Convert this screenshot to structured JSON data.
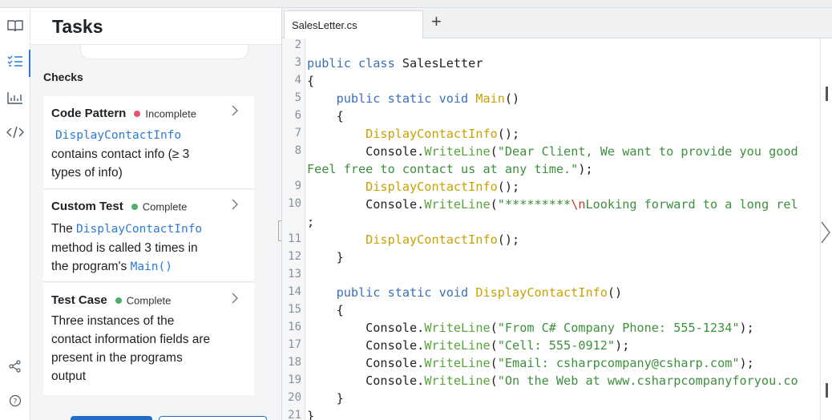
{
  "rail": {
    "icons": [
      "book-icon",
      "checklist-icon",
      "chart-icon",
      "code-icon",
      "share-icon",
      "help-icon"
    ]
  },
  "tasks": {
    "title": "Tasks",
    "checks_label": "Checks",
    "cards": [
      {
        "title": "Code Pattern",
        "status": "Incomplete",
        "status_color": "#e5566b",
        "code": "DisplayContactInfo",
        "desc_line1": "contains contact info (≥ 3",
        "desc_line2": "types of info)"
      },
      {
        "title": "Custom Test",
        "status": "Complete",
        "status_color": "#4caf6a",
        "pre": "The",
        "code": "DisplayContactInfo",
        "line2": "method is called 3 times in",
        "line3_pre": "the program's",
        "line3_code": "Main()"
      },
      {
        "title": "Test Case",
        "status": "Complete",
        "status_color": "#4caf6a",
        "lines": [
          "Three instances of the",
          "contact information fields are",
          "present in the programs",
          "output"
        ]
      }
    ]
  },
  "editor": {
    "tab_label": "SalesLetter.cs",
    "new_tab_symbol": "+",
    "line_numbers": [
      "2",
      "3",
      "4",
      "5",
      "6",
      "7",
      "8",
      "9",
      "10",
      "11",
      "12",
      "13",
      "14",
      "15",
      "16",
      "17",
      "18",
      "19",
      "20",
      "21"
    ],
    "code": {
      "l3_kw": "public class",
      "l3_rest": " SalesLetter",
      "l4": "{",
      "l5_kw": "    public static void",
      "l5_fn": " Main",
      "l5_rest": "()",
      "l6": "    {",
      "l7_fn": "        DisplayContactInfo",
      "l7_rest": "();",
      "l8_a": "        Console.",
      "l8_m": "WriteLine",
      "l8_b": "(",
      "l8_s": "\"Dear Client, We want to provide you good",
      "l8w": "Feel free to contact us at any time.\"",
      "l8w_rest": ");",
      "l9_fn": "        DisplayContactInfo",
      "l9_rest": "();",
      "l10_a": "        Console.",
      "l10_m": "WriteLine",
      "l10_b": "(",
      "l10_s1": "\"*********",
      "l10_esc": "\\n",
      "l10_s2": "Looking forward to a long rel",
      "l10w": ";",
      "l11_fn": "        DisplayContactInfo",
      "l11_rest": "();",
      "l12": "    }",
      "l14_kw": "    public static void",
      "l14_fn": " DisplayContactInfo",
      "l14_rest": "()",
      "l15": "    {",
      "l16_a": "        Console.",
      "l16_m": "WriteLine",
      "l16_b": "(",
      "l16_s": "\"From C# Company Phone: 555-1234\"",
      "l16_c": ");",
      "l17_a": "        Console.",
      "l17_m": "WriteLine",
      "l17_b": "(",
      "l17_s": "\"Cell: 555-0912\"",
      "l17_c": ");",
      "l18_a": "        Console.",
      "l18_m": "WriteLine",
      "l18_b": "(",
      "l18_s": "\"Email: csharpcompany@csharp.com\"",
      "l18_c": ");",
      "l19_a": "        Console.",
      "l19_m": "WriteLine",
      "l19_b": "(",
      "l19_s": "\"On the Web at www.csharpcompanyforyou.co",
      "l20": "    }",
      "l21": "}"
    }
  }
}
